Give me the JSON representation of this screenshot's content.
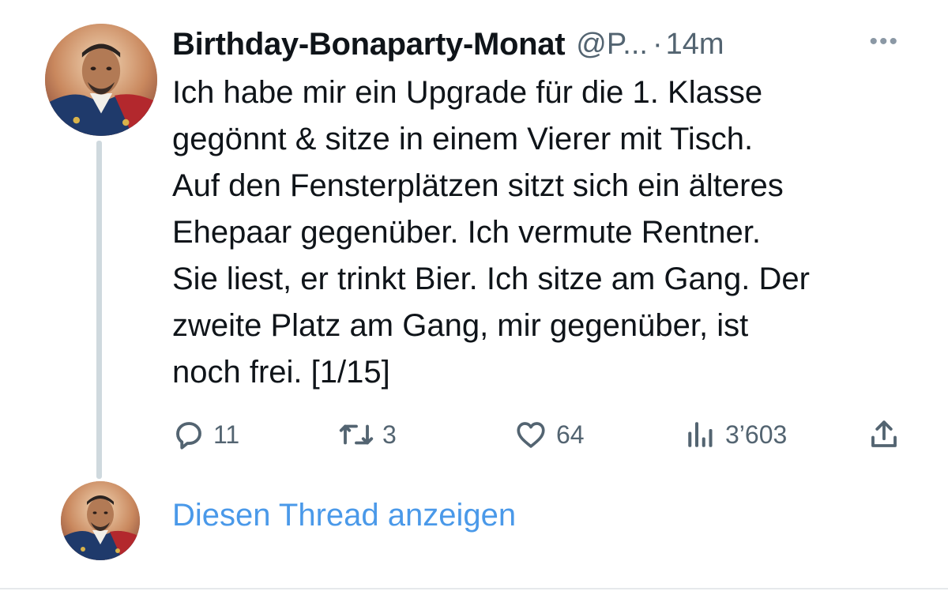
{
  "tweet": {
    "display_name": "Birthday-Bonaparty-Monat",
    "handle": "@P...",
    "separator": "·",
    "time": "14m",
    "more_label": "•••",
    "text": "Ich habe mir ein Upgrade für die 1. Klasse\ngegönnt & sitze in einem Vierer mit Tisch.\nAuf den Fensterplätzen sitzt sich ein älteres\nEhepaar gegenüber. Ich vermute Rentner.\nSie liest, er trinkt Bier. Ich sitze am Gang. Der\nzweite Platz am Gang, mir gegenüber, ist\nnoch frei. [1/15]"
  },
  "actions": {
    "replies": "11",
    "retweets": "3",
    "likes": "64",
    "views": "3’603"
  },
  "icons": {
    "reply": "reply-icon",
    "retweet": "retweet-icon",
    "like": "heart-icon",
    "views": "views-icon",
    "share": "share-icon",
    "more": "more-icon"
  },
  "thread": {
    "show_label": "Diesen Thread anzeigen"
  },
  "colors": {
    "text": "#0f1419",
    "secondary": "#536471",
    "link": "#4a99e9",
    "thread_line": "#cfd9de"
  }
}
